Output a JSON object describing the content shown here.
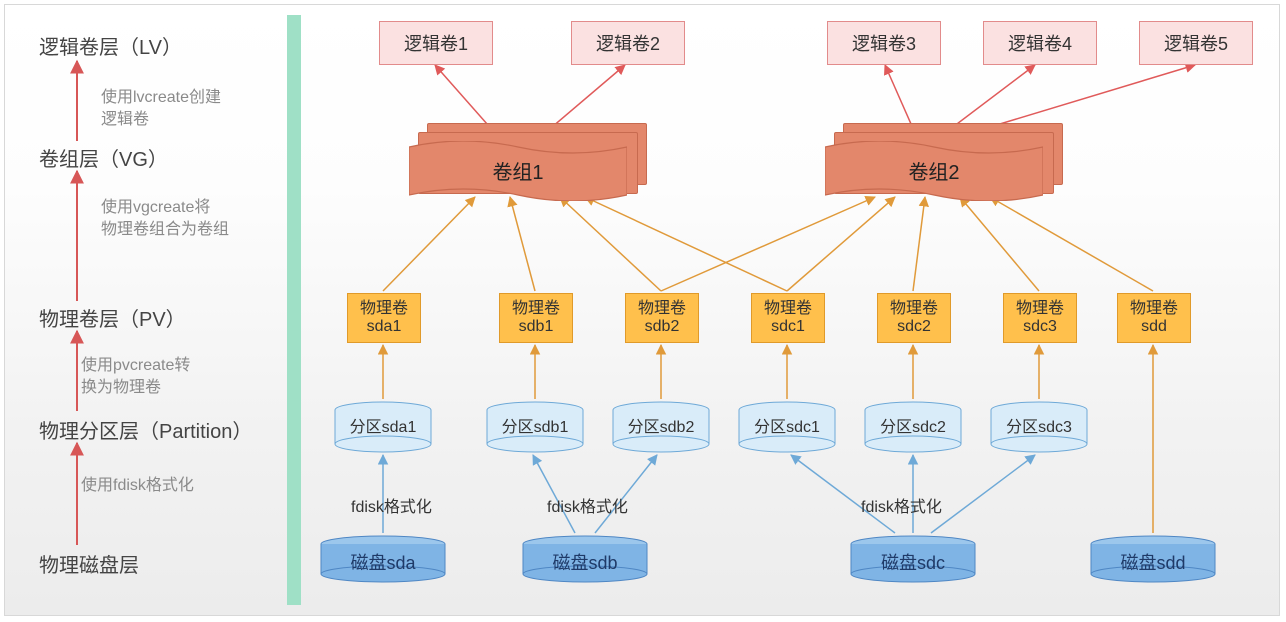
{
  "legend": {
    "lv": "逻辑卷层（LV）",
    "lv_note": "使用lvcreate创建\n逻辑卷",
    "vg": "卷组层（VG）",
    "vg_note": "使用vgcreate将\n物理卷组合为卷组",
    "pv": "物理卷层（PV）",
    "pv_note": "使用pvcreate转\n换为物理卷",
    "part": "物理分区层（Partition）",
    "part_note": "使用fdisk格式化",
    "disk": "物理磁盘层"
  },
  "lvs": [
    "逻辑卷1",
    "逻辑卷2",
    "逻辑卷3",
    "逻辑卷4",
    "逻辑卷5"
  ],
  "vgs": [
    "卷组1",
    "卷组2"
  ],
  "pvs": [
    {
      "top": "物理卷",
      "bottom": "sda1"
    },
    {
      "top": "物理卷",
      "bottom": "sdb1"
    },
    {
      "top": "物理卷",
      "bottom": "sdb2"
    },
    {
      "top": "物理卷",
      "bottom": "sdc1"
    },
    {
      "top": "物理卷",
      "bottom": "sdc2"
    },
    {
      "top": "物理卷",
      "bottom": "sdc3"
    },
    {
      "top": "物理卷",
      "bottom": "sdd"
    }
  ],
  "parts": [
    "分区sda1",
    "分区sdb1",
    "分区sdb2",
    "分区sdc1",
    "分区sdc2",
    "分区sdc3"
  ],
  "disks": [
    "磁盘sda",
    "磁盘sdb",
    "磁盘sdc",
    "磁盘sdd"
  ],
  "fdisk_notes": [
    "fdisk格式化",
    "fdisk格式化",
    "fdisk格式化"
  ],
  "colors": {
    "lv_fill": "#fbe1e1",
    "lv_border": "#e28b8b",
    "vg_fill": "#e3876b",
    "vg_border": "#c76a4f",
    "pv_fill": "#ffc04c",
    "pv_border": "#e09a2a",
    "part_fill": "#d9ecf9",
    "part_border": "#6ea9d7",
    "disk_fill": "#7fb4e5",
    "disk_border": "#4f87c4",
    "divider": "#9fe0c6",
    "arrow_red": "#e05a5a",
    "arrow_orange": "#e09a3a",
    "arrow_blue": "#6ea9d7",
    "arrow_legend": "#d75757"
  }
}
